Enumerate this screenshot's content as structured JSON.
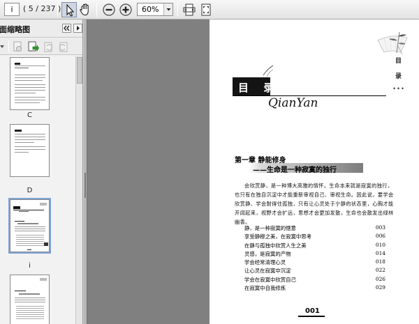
{
  "toolbar": {
    "page_value": "i",
    "page_count": "( 5 / 237 )",
    "zoom_value": "60%",
    "icons": [
      "select-arrow-icon",
      "hand-tool-icon",
      "zoom-out-icon",
      "zoom-in-icon",
      "fit-width-icon",
      "fit-page-icon"
    ]
  },
  "panel": {
    "title": "页面缩略图",
    "thumbnails": [
      {
        "label": "C"
      },
      {
        "label": "D"
      },
      {
        "label": "i"
      },
      {
        "label": ""
      }
    ]
  },
  "document": {
    "side_title": [
      "目",
      "录"
    ],
    "side_dots": "✦✦✦",
    "heading": "目 录",
    "script_title": "QianYan",
    "chapter": "第一章  静能修身",
    "subtitle": "——生命是一种寂寞的独行",
    "intro_lines": [
      "会欣赏静，是一种博大高雅的情怀。生命本来就是寂寞的独行，",
      "也只有在独自沉淀中才能重新审视自己、审视生命。因此说，要学会",
      "欣赏静、学会耐得住孤独，只有让心灵处于宁静的状态里，心胸才能",
      "开阔起来，视野才会扩远，思想才会更加发散，生命也会散发出绿林",
      "幽香。"
    ],
    "toc": [
      {
        "title": "静，是一种寂寞的惬意",
        "page": "003"
      },
      {
        "title": "享受静穆之美，在寂寞中思考",
        "page": "006"
      },
      {
        "title": "在静与孤独中欣赏人生之美",
        "page": "010"
      },
      {
        "title": "灵感，是寂寞的产物",
        "page": "014"
      },
      {
        "title": "学会经常清理心灵",
        "page": "018"
      },
      {
        "title": "让心灵在寂寞中沉淀",
        "page": "022"
      },
      {
        "title": "学会在寂寞中欣赏自己",
        "page": "026"
      },
      {
        "title": "在寂寞中自我修炼",
        "page": "029"
      }
    ],
    "page_number": "001"
  }
}
